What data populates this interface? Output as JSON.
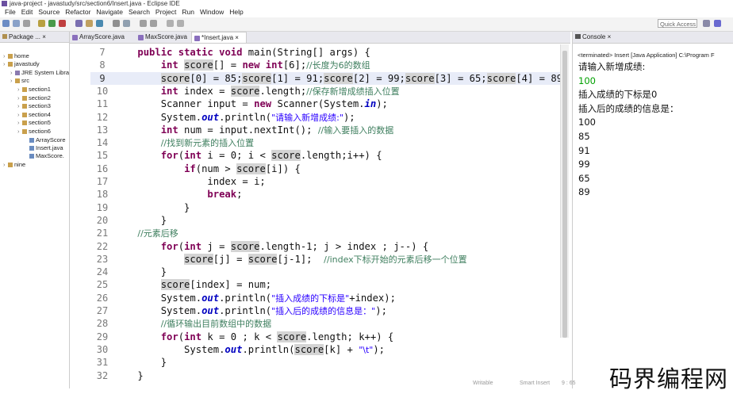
{
  "window": {
    "title": "java-project - javastudy/src/section6/Insert.java - Eclipse IDE"
  },
  "menu": [
    "File",
    "Edit",
    "Source",
    "Refactor",
    "Navigate",
    "Search",
    "Project",
    "Run",
    "Window",
    "Help"
  ],
  "toolbar": {
    "quick_access": "Quick Access"
  },
  "package_explorer": {
    "tab_label": "Package ...",
    "tree": [
      {
        "label": "home",
        "depth": 0,
        "icon": "project-icon"
      },
      {
        "label": "javastudy",
        "depth": 0,
        "icon": "project-icon"
      },
      {
        "label": "JRE System Libra",
        "depth": 1,
        "icon": "library-icon"
      },
      {
        "label": "src",
        "depth": 1,
        "icon": "source-folder-icon"
      },
      {
        "label": "section1",
        "depth": 2,
        "icon": "package-icon"
      },
      {
        "label": "section2",
        "depth": 2,
        "icon": "package-icon"
      },
      {
        "label": "section3",
        "depth": 2,
        "icon": "package-icon"
      },
      {
        "label": "section4",
        "depth": 2,
        "icon": "package-icon"
      },
      {
        "label": "section5",
        "depth": 2,
        "icon": "package-icon"
      },
      {
        "label": "section6",
        "depth": 2,
        "icon": "package-icon"
      },
      {
        "label": "ArrayScore",
        "depth": 3,
        "icon": "java-file-icon"
      },
      {
        "label": "Insert.java",
        "depth": 3,
        "icon": "java-file-icon"
      },
      {
        "label": "MaxScore.",
        "depth": 3,
        "icon": "java-file-icon"
      },
      {
        "label": "nine",
        "depth": 0,
        "icon": "project-icon"
      }
    ]
  },
  "editor": {
    "tabs": [
      {
        "label": "ArrayScore.java",
        "active": false
      },
      {
        "label": "MaxScore.java",
        "active": false
      },
      {
        "label": "*Insert.java",
        "active": true
      }
    ],
    "line_numbers": [
      "7",
      "8",
      "9",
      "10",
      "11",
      "12",
      "13",
      "14",
      "15",
      "16",
      "17",
      "18",
      "19",
      "20",
      "21",
      "22",
      "23",
      "24",
      "25",
      "26",
      "27",
      "28",
      "29",
      "30",
      "31",
      "32"
    ],
    "highlighted_line": "9",
    "code_lines": [
      "    public static void main(String[] args) {",
      "        int score[] = new int[6];//长度为6的数组",
      "        score[0] = 85;score[1] = 91;score[2] = 99;score[3] = 65;score[4] = 89;",
      "        int index = score.length;//保存新增成绩插入位置",
      "        Scanner input = new Scanner(System.in);",
      "        System.out.println(\"请输入新增成绩:\");",
      "        int num = input.nextInt(); //输入要插入的数据",
      "        //找到新元素的插入位置",
      "        for(int i = 0; i < score.length;i++) {",
      "            if(num > score[i]) {",
      "                index = i;",
      "                break;",
      "            }",
      "        }",
      "    //元素后移",
      "        for(int j = score.length-1; j > index ; j--) {",
      "            score[j] = score[j-1];  //index下标开始的元素后移一个位置",
      "        }",
      "        score[index] = num;",
      "        System.out.println(\"插入成绩的下标是\"+index);",
      "        System.out.println(\"插入后的成绩的信息是：\");",
      "        //循环输出目前数组中的数据",
      "        for(int k = 0 ; k < score.length; k++) {",
      "            System.out.println(score[k] + \"\\t\");",
      "        }",
      "    }"
    ]
  },
  "console": {
    "tab_label": "Console",
    "status": "<terminated> Insert [Java Application] C:\\Program F",
    "output": [
      {
        "text": "请输入新增成绩:",
        "input": false
      },
      {
        "text": "100",
        "input": true
      },
      {
        "text": "插入成绩的下标是0",
        "input": false
      },
      {
        "text": "插入后的成绩的信息是：",
        "input": false
      },
      {
        "text": "100",
        "input": false
      },
      {
        "text": "85",
        "input": false
      },
      {
        "text": "91",
        "input": false
      },
      {
        "text": "99",
        "input": false
      },
      {
        "text": "65",
        "input": false
      },
      {
        "text": "89",
        "input": false
      }
    ]
  },
  "statusbar": {
    "mode": "Writable",
    "insert": "Smart Insert",
    "position": "9 : 65"
  },
  "watermark": "码界编程网",
  "colors": {
    "keyword": "#7f0055",
    "comment": "#3f7f5f",
    "string": "#2a00ff",
    "field": "#0000c0",
    "console_input": "#00a000"
  }
}
